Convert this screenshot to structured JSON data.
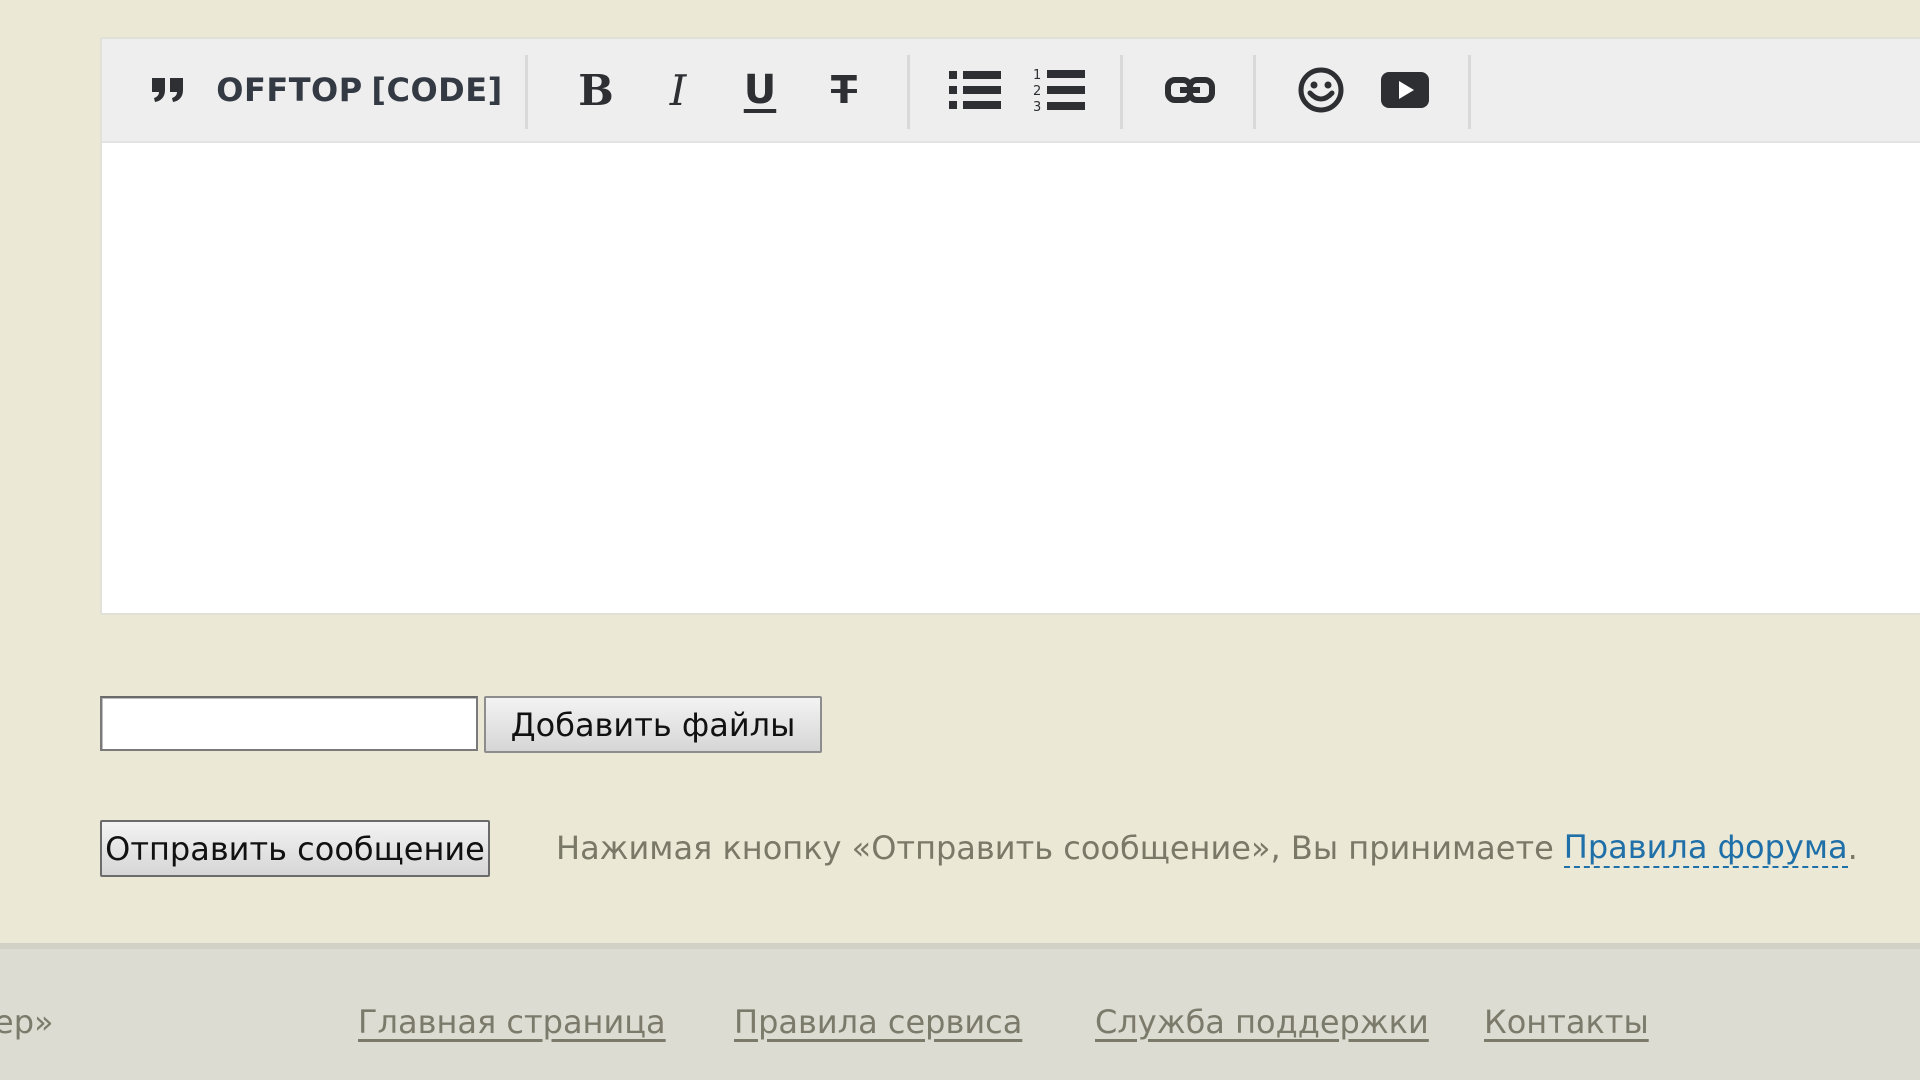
{
  "toolbar": {
    "quote": "”",
    "offtop": "OFFTOP",
    "code": "[CODE]",
    "bold": "B",
    "italic": "I",
    "underline": "U",
    "strike": "T",
    "icons": [
      "quote-icon",
      "bold-icon",
      "italic-icon",
      "underline-icon",
      "strikethrough-icon",
      "bulleted-list-icon",
      "numbered-list-icon",
      "link-icon",
      "smiley-icon",
      "youtube-icon"
    ]
  },
  "editor": {
    "value": ""
  },
  "attachments": {
    "file_value": "",
    "add_label": "Добавить файлы"
  },
  "submit": {
    "label": "Отправить сообщение",
    "agreement_text": "Нажимая кнопку «Отправить сообщение», Вы принимаете",
    "rules_link": "Правила форума",
    "period": "."
  },
  "footer": {
    "cut_text": "ер»",
    "links": [
      "Главная страница",
      "Правила сервиса",
      "Служба поддержки",
      "Контакты"
    ]
  },
  "colors": {
    "background": "#ebe8d6",
    "link": "#1f6fa8",
    "footer_bg": "#dddcd2",
    "muted_text": "#7a7866"
  }
}
